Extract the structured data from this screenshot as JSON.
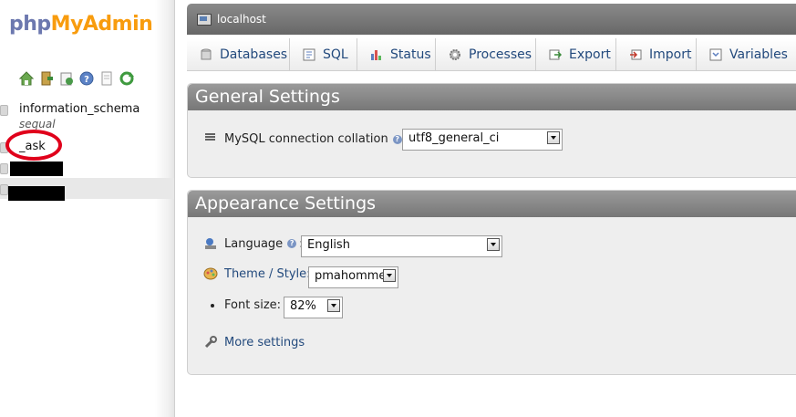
{
  "logo": {
    "part1": "php",
    "part2": "MyAdmin"
  },
  "nav_icons": [
    "home-icon",
    "exit-icon",
    "sql-query-icon",
    "help-icon",
    "docs-icon",
    "reload-icon"
  ],
  "databases": [
    {
      "name": "information_schema",
      "selected": false
    },
    {
      "name": "_ask",
      "selected": false
    },
    {
      "name": "",
      "selected": false,
      "redacted": true
    },
    {
      "name": "_",
      "selected": true,
      "redacted": true
    }
  ],
  "peek_text": "sequal",
  "server": {
    "label": "localhost"
  },
  "tabs": [
    {
      "label": "Databases",
      "icon": "database-icon"
    },
    {
      "label": "SQL",
      "icon": "sql-icon"
    },
    {
      "label": "Status",
      "icon": "status-chart-icon"
    },
    {
      "label": "Processes",
      "icon": "gear-icon"
    },
    {
      "label": "Export",
      "icon": "export-icon"
    },
    {
      "label": "Import",
      "icon": "import-icon"
    },
    {
      "label": "Variables",
      "icon": "variables-icon"
    }
  ],
  "general_settings": {
    "title": "General Settings",
    "collation_label": "MySQL connection collation",
    "collation_value": "utf8_general_ci"
  },
  "appearance_settings": {
    "title": "Appearance Settings",
    "language_label": "Language",
    "language_value": "English",
    "theme_label": "Theme / Style:",
    "theme_value": "pmahomme",
    "font_size_label": "Font size:",
    "font_size_value": "82%",
    "more_settings_label": "More settings"
  },
  "colors": {
    "logo_php": "#6c78af",
    "logo_myadmin": "#f89c0e",
    "link": "#234a7d",
    "annotation": "#e0001b"
  }
}
